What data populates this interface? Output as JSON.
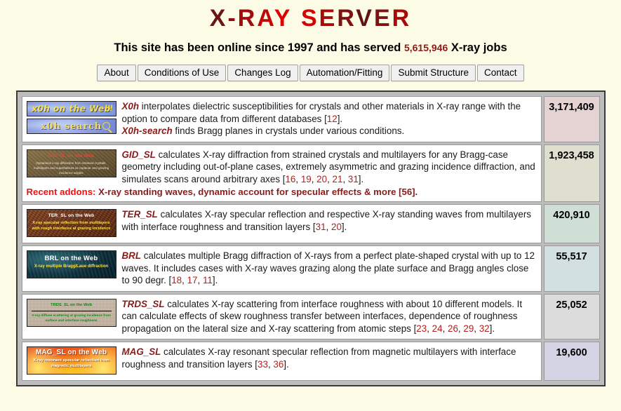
{
  "header": {
    "title_chars": [
      "X",
      "-",
      "R",
      "A",
      "Y",
      " ",
      "S",
      "E",
      "R",
      "V",
      "E",
      "R"
    ],
    "subtitle_before": "This site has been online since 1997 and has served",
    "served_count": "5,615,946",
    "subtitle_after": "X-ray jobs"
  },
  "nav": {
    "items": [
      {
        "label": "About"
      },
      {
        "label": "Conditions of Use"
      },
      {
        "label": "Changes Log"
      },
      {
        "label": "Automation/Fitting"
      },
      {
        "label": "Submit Structure"
      },
      {
        "label": "Contact"
      }
    ]
  },
  "rows": [
    {
      "id": "x0h",
      "banner": {
        "title": "x0h on the Web",
        "subtitle": "",
        "exclaim": "!!!"
      },
      "banner2": {
        "title": "x0h search"
      },
      "links": [
        {
          "name": "X0h",
          "text": " interpolates dielectric susceptibilities for crystals and other materials in X-ray range with the option to compare data from different databases [",
          "refs": [
            "12"
          ],
          "tail": "]."
        },
        {
          "name": "X0h-search",
          "text": " finds Bragg planes in crystals under various conditions.",
          "refs": [],
          "tail": ""
        }
      ],
      "count": "3,171,409",
      "count_bg": "#e5d2d2"
    },
    {
      "id": "gid_sl",
      "banner": {
        "title": "GID_SL on the Web",
        "subtitle": "Dynamical x-ray diffraction from strained crystals, multilayers and superlattices at coplanar and grazing incidence angles"
      },
      "link": "GID_SL",
      "text": " calculates X-ray diffraction from strained crystals and multilayers for any Bragg-case geometry including out-of-plane cases, extremely asymmetric and grazing incidence diffraction, and simulates scans around arbitrary axes [",
      "refs": [
        "16",
        "19",
        "20",
        "21",
        "31"
      ],
      "tail": "].",
      "addons_label": "Recent addons:",
      "addons_text": " X-ray standing waves, dynamic account for specular effects & more [",
      "addons_ref": "56",
      "addons_tail": "].",
      "count": "1,923,458",
      "count_bg": "#dedfcf"
    },
    {
      "id": "ter_sl",
      "banner": {
        "title": "TER_SL on the Web",
        "subtitle": "X-ray specular reflection from multilayers with rough interfaces at grazing incidence"
      },
      "link": "TER_SL",
      "text": " calculates X-ray specular reflection and respective X-ray standing waves from multilayers with interface roughness and transition layers [",
      "refs": [
        "31",
        "20"
      ],
      "tail": "].",
      "count": "420,910",
      "count_bg": "#cfdfd5"
    },
    {
      "id": "brl",
      "banner": {
        "title": "BRL on the Web",
        "subtitle": "X-ray multiple Bragg/Laue diffraction"
      },
      "link": "BRL",
      "text": " calculates multiple Bragg diffraction of X-rays from a perfect plate-shaped crystal with up to 12 waves. It includes cases with X-ray waves grazing along the plate surface and Bragg angles close to 90 degr. [",
      "refs": [
        "18",
        "17",
        "11"
      ],
      "tail": "].",
      "count": "55,517",
      "count_bg": "#d2e0e2"
    },
    {
      "id": "trds_sl",
      "banner": {
        "title": "TRDS_SL on the Web",
        "subtitle": "X-ray diffuse scattering at grazing incidence from surface and interface roughness"
      },
      "link": "TRDS_SL",
      "text": " calculates X-ray scattering from interface roughness with about 10 different models. It can calculate effects of skew roughness transfer between interfaces, dependence of roughness propagation on the lateral size and X-ray scattering from atomic steps [",
      "refs": [
        "23",
        "24",
        "26",
        "29",
        "32"
      ],
      "tail": "].",
      "count": "25,052",
      "count_bg": "#dcdcdc"
    },
    {
      "id": "mag_sl",
      "banner": {
        "title": "MAG_SL on the Web",
        "subtitle": "X-ray resonant specular reflection from magnetic multilayers"
      },
      "link": "MAG_SL",
      "text": " calculates X-ray resonant specular reflection from magnetic multilayers with interface roughness and transition layers [",
      "refs": [
        "33",
        "36"
      ],
      "tail": "].",
      "count": "19,600",
      "count_bg": "#d3d3e3"
    }
  ]
}
